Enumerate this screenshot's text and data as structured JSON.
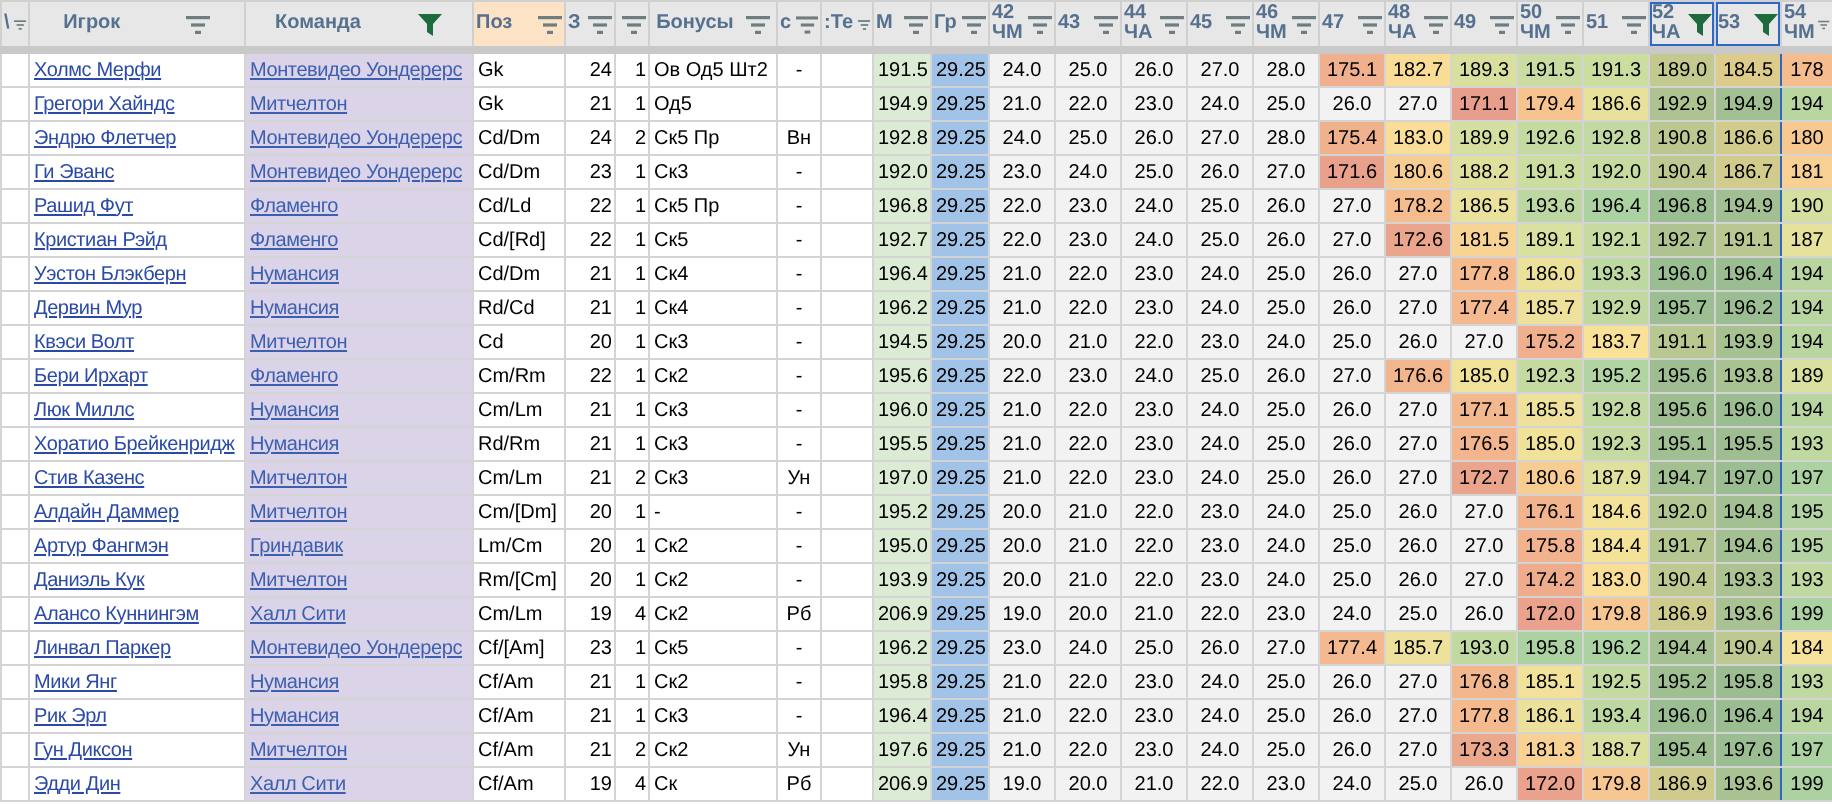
{
  "columns": [
    {
      "label": "\\",
      "filtered": false,
      "selected": false,
      "highlighted": false
    },
    {
      "label": "Игрок",
      "filtered": false,
      "selected": false,
      "highlighted": false
    },
    {
      "label": "Команда",
      "filtered": true,
      "selected": false,
      "highlighted": false
    },
    {
      "label": "Поз",
      "filtered": false,
      "selected": false,
      "highlighted": true
    },
    {
      "label": "З",
      "filtered": false,
      "selected": false,
      "highlighted": false
    },
    {
      "filtered": false,
      "selected": false,
      "highlighted": false
    },
    {
      "label": "Бонусы",
      "filtered": false,
      "selected": false,
      "highlighted": false
    },
    {
      "label": "с",
      "filtered": false,
      "selected": false,
      "highlighted": false
    },
    {
      "label": ":Те",
      "filtered": false,
      "selected": false,
      "highlighted": false
    },
    {
      "label": "М",
      "filtered": false,
      "selected": false,
      "highlighted": false
    },
    {
      "label": "Гр",
      "filtered": false,
      "selected": false,
      "highlighted": false
    },
    {
      "label": "42",
      "sub": "ЧМ",
      "filtered": false,
      "selected": false,
      "highlighted": false
    },
    {
      "label": "43",
      "filtered": false,
      "selected": false,
      "highlighted": false
    },
    {
      "label": "44",
      "sub": "ЧА",
      "filtered": false,
      "selected": false,
      "highlighted": false
    },
    {
      "label": "45",
      "filtered": false,
      "selected": false,
      "highlighted": false
    },
    {
      "label": "46",
      "sub": "ЧМ",
      "filtered": false,
      "selected": false,
      "highlighted": false
    },
    {
      "label": "47",
      "filtered": false,
      "selected": false,
      "highlighted": false
    },
    {
      "label": "48",
      "sub": "ЧА",
      "filtered": false,
      "selected": false,
      "highlighted": false
    },
    {
      "label": "49",
      "filtered": false,
      "selected": false,
      "highlighted": false
    },
    {
      "label": "50",
      "sub": "ЧМ",
      "filtered": false,
      "selected": false,
      "highlighted": false
    },
    {
      "label": "51",
      "filtered": false,
      "selected": false,
      "highlighted": false
    },
    {
      "label": "52",
      "sub": "ЧА",
      "filtered": true,
      "selected": true,
      "highlighted": false
    },
    {
      "label": "53",
      "filtered": true,
      "selected": true,
      "highlighted": false
    },
    {
      "label": "54",
      "sub": "ЧМ",
      "filtered": false,
      "selected": false,
      "highlighted": false
    }
  ],
  "rows": [
    {
      "player": "Холмс Мерфи",
      "team": "Монтевидео Уондерерс",
      "position": "Gk",
      "column_4": "24",
      "column_5": "1",
      "bonuses": "Ов Од5 Шт2",
      "column_7": "-",
      "column_9": "191.5",
      "column_10": "29.25",
      "weeks": [
        "24.0",
        "25.0",
        "26.0",
        "27.0",
        "28.0",
        "175.1",
        "182.7",
        "189.3",
        "191.5",
        "191.3",
        "189.0",
        "184.5",
        "178"
      ]
    },
    {
      "player": "Грегори Хайндс",
      "team": "Митчелтон",
      "position": "Gk",
      "column_4": "21",
      "column_5": "1",
      "bonuses": "Од5",
      "column_9": "194.9",
      "column_10": "29.25",
      "weeks": [
        "21.0",
        "22.0",
        "23.0",
        "24.0",
        "25.0",
        "26.0",
        "27.0",
        "171.1",
        "179.4",
        "186.6",
        "192.9",
        "194.9",
        "194"
      ]
    },
    {
      "player": "Эндрю Флетчер",
      "team": "Монтевидео Уондерерс",
      "position": "Cd/Dm",
      "column_4": "24",
      "column_5": "2",
      "bonuses": "Ск5 Пр",
      "column_7": "Вн",
      "column_9": "192.8",
      "column_10": "29.25",
      "weeks": [
        "24.0",
        "25.0",
        "26.0",
        "27.0",
        "28.0",
        "175.4",
        "183.0",
        "189.9",
        "192.6",
        "192.8",
        "190.8",
        "186.6",
        "180"
      ]
    },
    {
      "player": "Ги Эванс",
      "team": "Монтевидео Уондерерс",
      "position": "Cd/Dm",
      "column_4": "23",
      "column_5": "1",
      "bonuses": "Ск3",
      "column_7": "-",
      "column_9": "192.0",
      "column_10": "29.25",
      "weeks": [
        "23.0",
        "24.0",
        "25.0",
        "26.0",
        "27.0",
        "171.6",
        "180.6",
        "188.2",
        "191.3",
        "192.0",
        "190.4",
        "186.7",
        "181"
      ]
    },
    {
      "player": "Рашид Фут",
      "team": "Фламенго",
      "position": "Cd/Ld",
      "column_4": "22",
      "column_5": "1",
      "bonuses": "Ск5 Пр",
      "column_7": "-",
      "column_9": "196.8",
      "column_10": "29.25",
      "weeks": [
        "22.0",
        "23.0",
        "24.0",
        "25.0",
        "26.0",
        "27.0",
        "178.2",
        "186.5",
        "193.6",
        "196.4",
        "196.8",
        "194.9",
        "190"
      ]
    },
    {
      "player": "Кристиан Рэйд",
      "team": "Фламенго",
      "position": "Cd/[Rd]",
      "column_4": "22",
      "column_5": "1",
      "bonuses": "Ск5",
      "column_7": "-",
      "column_9": "192.7",
      "column_10": "29.25",
      "weeks": [
        "22.0",
        "23.0",
        "24.0",
        "25.0",
        "26.0",
        "27.0",
        "172.6",
        "181.5",
        "189.1",
        "192.1",
        "192.7",
        "191.1",
        "187"
      ]
    },
    {
      "player": "Уэстон Блэкберн",
      "team": "Нумансия",
      "position": "Cd/Dm",
      "column_4": "21",
      "column_5": "1",
      "bonuses": "Ск4",
      "column_7": "-",
      "column_9": "196.4",
      "column_10": "29.25",
      "weeks": [
        "21.0",
        "22.0",
        "23.0",
        "24.0",
        "25.0",
        "26.0",
        "27.0",
        "177.8",
        "186.0",
        "193.3",
        "196.0",
        "196.4",
        "194"
      ]
    },
    {
      "player": "Дервин Мур",
      "team": "Нумансия",
      "position": "Rd/Cd",
      "column_4": "21",
      "column_5": "1",
      "bonuses": "Ск4",
      "column_7": "-",
      "column_9": "196.2",
      "column_10": "29.25",
      "weeks": [
        "21.0",
        "22.0",
        "23.0",
        "24.0",
        "25.0",
        "26.0",
        "27.0",
        "177.4",
        "185.7",
        "192.9",
        "195.7",
        "196.2",
        "194"
      ]
    },
    {
      "player": "Квэси Волт",
      "team": "Митчелтон",
      "position": "Cd",
      "column_4": "20",
      "column_5": "1",
      "bonuses": "Ск3",
      "column_7": "-",
      "column_9": "194.5",
      "column_10": "29.25",
      "weeks": [
        "20.0",
        "21.0",
        "22.0",
        "23.0",
        "24.0",
        "25.0",
        "26.0",
        "27.0",
        "175.2",
        "183.7",
        "191.1",
        "193.9",
        "194"
      ]
    },
    {
      "player": "Бери Ирхарт",
      "team": "Фламенго",
      "position": "Cm/Rm",
      "column_4": "22",
      "column_5": "1",
      "bonuses": "Ск2",
      "column_7": "-",
      "column_9": "195.6",
      "column_10": "29.25",
      "weeks": [
        "22.0",
        "23.0",
        "24.0",
        "25.0",
        "26.0",
        "27.0",
        "176.6",
        "185.0",
        "192.3",
        "195.2",
        "195.6",
        "193.8",
        "189"
      ]
    },
    {
      "player": "Люк Миллс",
      "team": "Нумансия",
      "position": "Cm/Lm",
      "column_4": "21",
      "column_5": "1",
      "bonuses": "Ск3",
      "column_7": "-",
      "column_9": "196.0",
      "column_10": "29.25",
      "weeks": [
        "21.0",
        "22.0",
        "23.0",
        "24.0",
        "25.0",
        "26.0",
        "27.0",
        "177.1",
        "185.5",
        "192.8",
        "195.6",
        "196.0",
        "194"
      ]
    },
    {
      "player": "Хоратио Брейкенридж",
      "team": "Нумансия",
      "position": "Rd/Rm",
      "column_4": "21",
      "column_5": "1",
      "bonuses": "Ск3",
      "column_7": "-",
      "column_9": "195.5",
      "column_10": "29.25",
      "weeks": [
        "21.0",
        "22.0",
        "23.0",
        "24.0",
        "25.0",
        "26.0",
        "27.0",
        "176.5",
        "185.0",
        "192.3",
        "195.1",
        "195.5",
        "193"
      ]
    },
    {
      "player": "Стив Казенс",
      "team": "Митчелтон",
      "position": "Cm/Lm",
      "column_4": "21",
      "column_5": "2",
      "bonuses": "Ск3",
      "column_7": "Ун",
      "column_9": "197.0",
      "column_10": "29.25",
      "weeks": [
        "21.0",
        "22.0",
        "23.0",
        "24.0",
        "25.0",
        "26.0",
        "27.0",
        "172.7",
        "180.6",
        "187.9",
        "194.7",
        "197.0",
        "197"
      ]
    },
    {
      "player": "Алдайн Даммер",
      "team": "Митчелтон",
      "position": "Cm/[Dm]",
      "column_4": "20",
      "column_5": "1",
      "bonuses": "-",
      "column_7": "-",
      "column_9": "195.2",
      "column_10": "29.25",
      "weeks": [
        "20.0",
        "21.0",
        "22.0",
        "23.0",
        "24.0",
        "25.0",
        "26.0",
        "27.0",
        "176.1",
        "184.6",
        "192.0",
        "194.8",
        "195"
      ]
    },
    {
      "player": "Артур Фангмэн",
      "team": "Гриндавик",
      "position": "Lm/Cm",
      "column_4": "20",
      "column_5": "1",
      "bonuses": "Ск2",
      "column_7": "-",
      "column_9": "195.0",
      "column_10": "29.25",
      "weeks": [
        "20.0",
        "21.0",
        "22.0",
        "23.0",
        "24.0",
        "25.0",
        "26.0",
        "27.0",
        "175.8",
        "184.4",
        "191.7",
        "194.6",
        "195"
      ]
    },
    {
      "player": "Даниэль Кук",
      "team": "Митчелтон",
      "position": "Rm/[Cm]",
      "column_4": "20",
      "column_5": "1",
      "bonuses": "Ск2",
      "column_7": "-",
      "column_9": "193.9",
      "column_10": "29.25",
      "weeks": [
        "20.0",
        "21.0",
        "22.0",
        "23.0",
        "24.0",
        "25.0",
        "26.0",
        "27.0",
        "174.2",
        "183.0",
        "190.4",
        "193.3",
        "193"
      ]
    },
    {
      "player": "Алансо Куннингэм",
      "team": "Халл Сити",
      "position": "Cm/Lm",
      "column_4": "19",
      "column_5": "4",
      "bonuses": "Ск2",
      "column_7": "Рб",
      "column_9": "206.9",
      "column_10": "29.25",
      "weeks": [
        "19.0",
        "20.0",
        "21.0",
        "22.0",
        "23.0",
        "24.0",
        "25.0",
        "26.0",
        "172.0",
        "179.8",
        "186.9",
        "193.6",
        "199"
      ]
    },
    {
      "player": "Линвал Паркер",
      "team": "Монтевидео Уондерерс",
      "position": "Cf/[Am]",
      "column_4": "23",
      "column_5": "1",
      "bonuses": "Ск5",
      "column_7": "-",
      "column_9": "196.2",
      "column_10": "29.25",
      "weeks": [
        "23.0",
        "24.0",
        "25.0",
        "26.0",
        "27.0",
        "177.4",
        "185.7",
        "193.0",
        "195.8",
        "196.2",
        "194.4",
        "190.4",
        "184"
      ]
    },
    {
      "player": "Мики Янг",
      "team": "Нумансия",
      "position": "Cf/Am",
      "column_4": "21",
      "column_5": "1",
      "bonuses": "Ск2",
      "column_7": "-",
      "column_9": "195.8",
      "column_10": "29.25",
      "weeks": [
        "21.0",
        "22.0",
        "23.0",
        "24.0",
        "25.0",
        "26.0",
        "27.0",
        "176.8",
        "185.1",
        "192.5",
        "195.2",
        "195.8",
        "193"
      ]
    },
    {
      "player": "Рик Эрл",
      "team": "Нумансия",
      "position": "Cf/Am",
      "column_4": "21",
      "column_5": "1",
      "bonuses": "Ск3",
      "column_7": "-",
      "column_9": "196.4",
      "column_10": "29.25",
      "weeks": [
        "21.0",
        "22.0",
        "23.0",
        "24.0",
        "25.0",
        "26.0",
        "27.0",
        "177.8",
        "186.1",
        "193.4",
        "196.0",
        "196.4",
        "194"
      ]
    },
    {
      "player": "Гун Диксон",
      "team": "Митчелтон",
      "position": "Cf/Am",
      "column_4": "21",
      "column_5": "2",
      "bonuses": "Ск2",
      "column_7": "Ун",
      "column_9": "197.6",
      "column_10": "29.25",
      "weeks": [
        "21.0",
        "22.0",
        "23.0",
        "24.0",
        "25.0",
        "26.0",
        "27.0",
        "173.3",
        "181.3",
        "188.7",
        "195.4",
        "197.6",
        "197"
      ]
    },
    {
      "player": "Эдди Дин",
      "team": "Халл Сити",
      "position": "Cf/Am",
      "column_4": "19",
      "column_5": "4",
      "bonuses": "Ск",
      "column_7": "Рб",
      "column_9": "206.9",
      "column_10": "29.25",
      "weeks": [
        "19.0",
        "20.0",
        "21.0",
        "22.0",
        "23.0",
        "24.0",
        "25.0",
        "26.0",
        "172.0",
        "179.8",
        "186.9",
        "193.6",
        "199"
      ]
    }
  ]
}
